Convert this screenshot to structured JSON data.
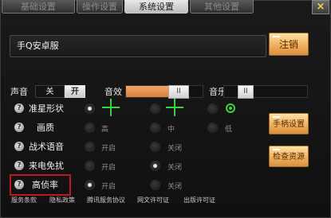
{
  "tabs": [
    "基础设置",
    "操作设置",
    "系统设置",
    "其他设置"
  ],
  "tab_close_glyph": "×",
  "server": {
    "name": "手Q安卓服",
    "logout_label": "注销"
  },
  "sound": {
    "sound_label": "声音",
    "sound_off": "关",
    "sound_on": "开",
    "sfx_label": "音效",
    "sfx_level_pct": 75,
    "music_label": "音乐",
    "music_level_pct": 20,
    "knob_glyph": "II"
  },
  "options": {
    "crosshair": {
      "label": "准星形状"
    },
    "quality": {
      "label": "画质",
      "choices": [
        "高",
        "中",
        "低"
      ]
    },
    "voice": {
      "label": "战术语音",
      "on": "开启",
      "off": "关闭"
    },
    "call": {
      "label": "来电免扰",
      "on": "开启",
      "off": "关闭"
    },
    "fps": {
      "label": "高侦率",
      "on": "开启",
      "off": "关闭"
    }
  },
  "buttons": {
    "controller": "手柄设置",
    "check_res": "检查资源"
  },
  "footer": [
    "服务条款",
    "隐私政策",
    "腾讯服务协议",
    "网文许可证",
    "出版许可证"
  ],
  "help_glyph": "?",
  "colors": {
    "accent_orange": "#e89a4e",
    "crosshair_green": "#3cd23c",
    "highlight_red": "#c0191d"
  }
}
